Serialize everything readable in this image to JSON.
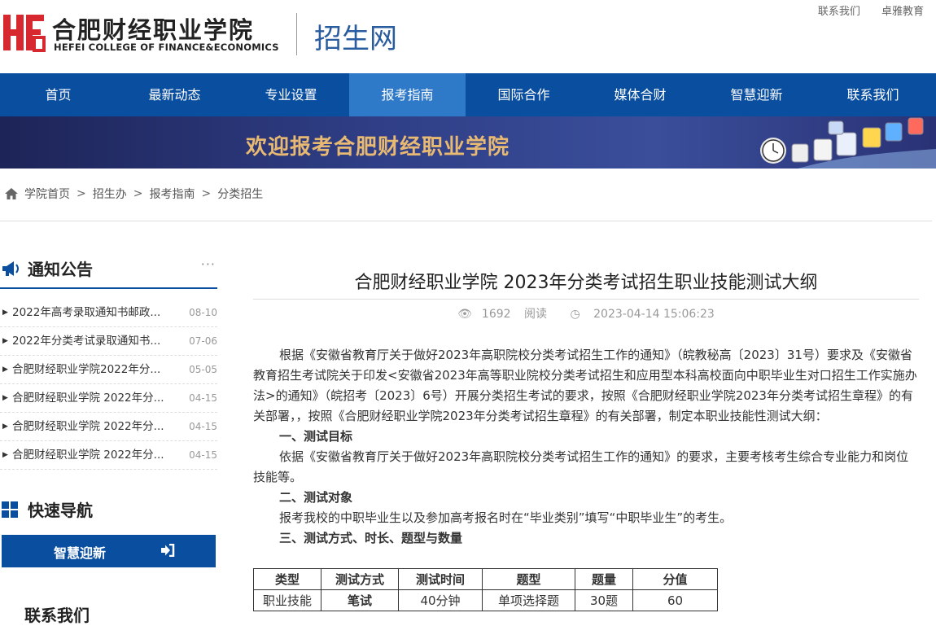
{
  "header": {
    "logo_cn": "合肥财经职业学院",
    "logo_en": "HEFEI COLLEGE OF FINANCE&ECONOMICS",
    "site_name": "招生网",
    "top_links": [
      "联系我们",
      "卓雅教育"
    ]
  },
  "nav": {
    "items": [
      "首页",
      "最新动态",
      "专业设置",
      "报考指南",
      "国际合作",
      "媒体合财",
      "智慧迎新",
      "联系我们"
    ],
    "active": "报考指南"
  },
  "banner": {
    "text": "欢迎报考合肥财经职业学院"
  },
  "breadcrumb": [
    "学院首页",
    "招生办",
    "报考指南",
    "分类招生"
  ],
  "sidebar": {
    "notice_title": "通知公告",
    "more": "···",
    "notices": [
      {
        "title": "2022年高考录取通知书邮政...",
        "date": "08-10"
      },
      {
        "title": "2022年分类考试录取通知书...",
        "date": "07-06"
      },
      {
        "title": "合肥财经职业学院2022年分...",
        "date": "05-05"
      },
      {
        "title": "合肥财经职业学院 2022年分...",
        "date": "04-15"
      },
      {
        "title": "合肥财经职业学院 2022年分...",
        "date": "04-15"
      },
      {
        "title": "合肥财经职业学院 2022年分...",
        "date": "04-15"
      }
    ],
    "quick_title": "快速导航",
    "quick_button": "智慧迎新",
    "contact_title": "联系我们"
  },
  "article": {
    "title": "合肥财经职业学院 2023年分类考试招生职业技能测试大纲",
    "views": "1692",
    "views_label": "阅读",
    "datetime": "2023-04-14 15:06:23",
    "paragraphs": [
      {
        "text": "根据《安徽省教育厅关于做好2023年高职院校分类考试招生工作的通知》（皖教秘高〔2023〕31号）要求及《安徽省教育招生考试院关于印发<安徽省2023年高等职业院校分类考试招生和应用型本科高校面向中职毕业生对口招生工作实施办法>的通知》（皖招考〔2023〕6号）开展分类招生考试的要求，按照《合肥财经职业学院2023年分类考试招生章程》的有关部署，，按照《合肥财经职业学院2023年分类考试招生章程》的有关部署，制定本职业技能性测试大纲：",
        "heading": false
      },
      {
        "text": "一、测试目标",
        "heading": true
      },
      {
        "text": "依据《安徽省教育厅关于做好2023年高职院校分类考试招生工作的通知》的要求，主要考核考生综合专业能力和岗位技能等。",
        "heading": false
      },
      {
        "text": "二、测试对象",
        "heading": true
      },
      {
        "text": "报考我校的中职毕业生以及参加高考报名时在“毕业类别”填写“中职毕业生”的考生。",
        "heading": false
      },
      {
        "text": "三、测试方式、时长、题型与数量",
        "heading": true
      }
    ],
    "table": {
      "headers": [
        "类型",
        "测试方式",
        "测试时间",
        "题型",
        "题量",
        "分值"
      ],
      "rows": [
        [
          "职业技能",
          "笔试",
          "40分钟",
          "单项选择题",
          "30题",
          "60"
        ]
      ]
    }
  },
  "colors": {
    "nav_bg": "#0a4ea0",
    "nav_active": "#2e7ac9",
    "banner_text": "#e8b972",
    "logo_red": "#d7282f"
  }
}
